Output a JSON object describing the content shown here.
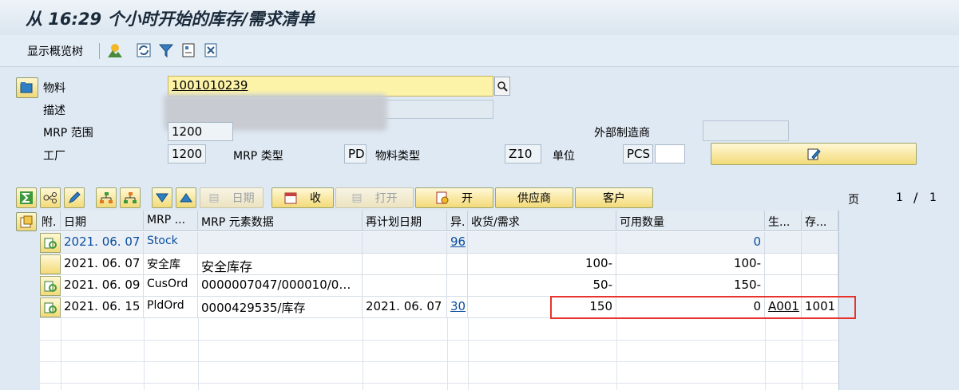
{
  "window": {
    "title": "从 16:29 个小时开始的库存/需求清单"
  },
  "toolbar": {
    "show_tree": "显示概览树",
    "icons": [
      "mountain-icon",
      "refresh-icon",
      "filter-icon",
      "settings-icon",
      "export-icon"
    ]
  },
  "header": {
    "material_label": "物料",
    "material_value": "1001010239",
    "description_label": "描述",
    "mrp_area_label": "MRP 范围",
    "mrp_area_value": "1200",
    "external_manufacturer_label": "外部制造商",
    "plant_label": "工厂",
    "plant_value": "1200",
    "mrp_type_label": "MRP 类型",
    "mrp_type_value": "PD",
    "material_type_label": "物料类型",
    "material_type_value": "Z10",
    "unit_label": "单位",
    "unit_value": "PCS"
  },
  "buttons": {
    "date": "日期",
    "receipt": "收",
    "open": "打开",
    "open2": "开",
    "supplier": "供应商",
    "customer": "客户"
  },
  "pager": {
    "label": "页",
    "current": "1",
    "separator": "/",
    "total": "1"
  },
  "table": {
    "columns": [
      "附.",
      "日期",
      "MRP ...",
      "MRP 元素数据",
      "再计划日期",
      "异.",
      "收货/需求",
      "可用数量",
      "生...",
      "存..."
    ],
    "rows": [
      {
        "date": "2021. 06. 07",
        "mrp": "Stock",
        "element_data": "",
        "reschedule": "",
        "exception": "96",
        "receipt_req": "",
        "available": "0",
        "gen": "",
        "stor": ""
      },
      {
        "date": "2021. 06. 07",
        "mrp": "安全库",
        "element_data": "安全库存",
        "reschedule": "",
        "exception": "",
        "receipt_req": "100-",
        "available": "100-",
        "gen": "",
        "stor": ""
      },
      {
        "date": "2021. 06. 09",
        "mrp": "CusOrd",
        "element_data": "0000007047/000010/0…",
        "reschedule": "",
        "exception": "",
        "receipt_req": "50-",
        "available": "150-",
        "gen": "",
        "stor": ""
      },
      {
        "date": "2021. 06. 15",
        "mrp": "PldOrd",
        "element_data": "0000429535/库存",
        "reschedule": "2021. 06. 07",
        "exception": "30",
        "receipt_req": "150",
        "available": "0",
        "gen": "A001",
        "stor": "1001"
      }
    ]
  },
  "colors": {
    "accent_button": "#f3da78",
    "highlight": "#e8322c",
    "link": "#0a4d9e"
  }
}
